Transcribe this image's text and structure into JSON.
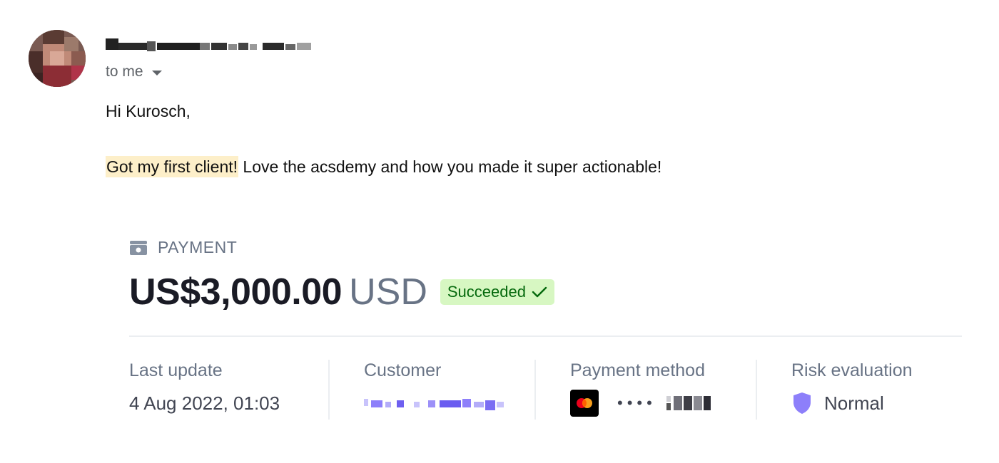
{
  "email": {
    "to_label": "to me",
    "greeting": "Hi Kurosch,",
    "message_highlight": "Got my first client!",
    "message_rest": " Love the acsdemy and how you made it super actionable!"
  },
  "payment": {
    "section_label": "PAYMENT",
    "amount": "US$3,000.00",
    "currency": "USD",
    "status": "Succeeded",
    "status_color": "#05690d",
    "status_bg": "#d7f7c2",
    "details": {
      "last_update_label": "Last update",
      "last_update_value": "4 Aug 2022, 01:03",
      "customer_label": "Customer",
      "payment_method_label": "Payment method",
      "card_mask": "••••",
      "risk_label": "Risk evaluation",
      "risk_value": "Normal"
    },
    "accent_color": "#8d7ffa"
  }
}
